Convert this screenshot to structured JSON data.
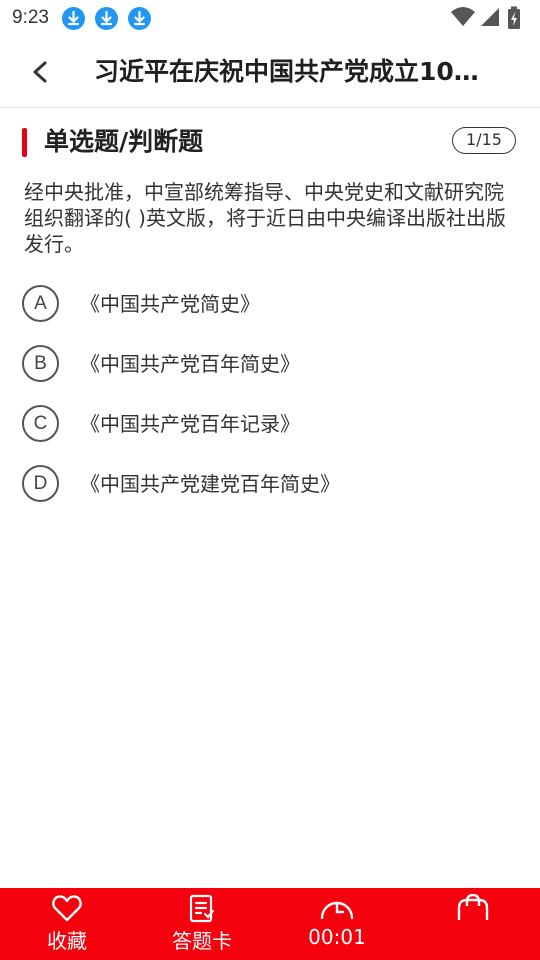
{
  "status_bar": {
    "time": "9:23",
    "icons": [
      "download-icon",
      "download-icon",
      "download-icon",
      "wifi-icon",
      "signal-icon",
      "battery-charging-icon"
    ]
  },
  "header": {
    "title": "习近平在庆祝中国共产党成立10…",
    "back_icon": "chevron-left-icon"
  },
  "section": {
    "title": "单选题/判断题",
    "progress": "1/15"
  },
  "question": {
    "text": "经中央批准，中宣部统筹指导、中央党史和文献研究院组织翻译的(    )英文版，将于近日由中央编译出版社出版发行。"
  },
  "options": [
    {
      "letter": "A",
      "text": "《中国共产党简史》"
    },
    {
      "letter": "B",
      "text": "《中国共产党百年简史》"
    },
    {
      "letter": "C",
      "text": "《中国共产党百年记录》"
    },
    {
      "letter": "D",
      "text": "《中国共产党建党百年简史》"
    }
  ],
  "bottom_bar": {
    "favorite_label": "收藏",
    "answer_card_label": "答题卡",
    "timer_label": "00:01",
    "accent_color": "#f5000d"
  }
}
